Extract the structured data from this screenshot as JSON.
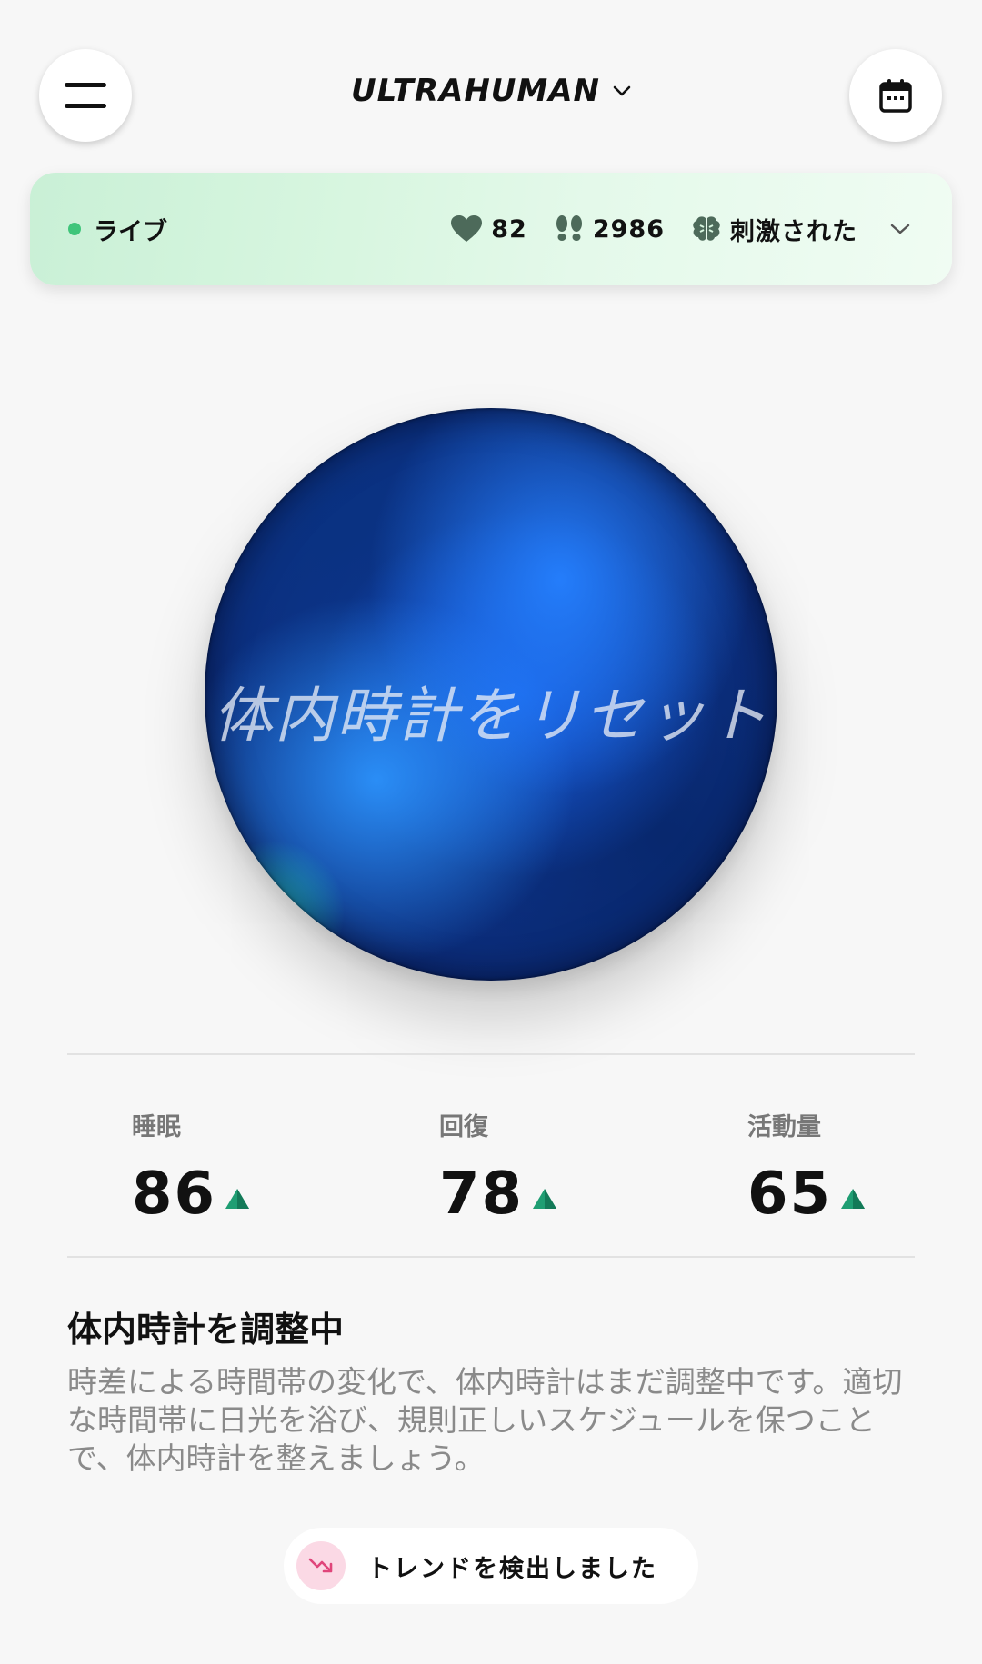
{
  "header": {
    "brand": "ULTRAHUMAN"
  },
  "live": {
    "label": "ライブ",
    "heart_rate": "82",
    "steps": "2986",
    "state": "刺激された"
  },
  "orb": {
    "text": "体内時計をリセット"
  },
  "scores": [
    {
      "label": "睡眠",
      "value": "86",
      "trend": "up"
    },
    {
      "label": "回復",
      "value": "78",
      "trend": "up"
    },
    {
      "label": "活動量",
      "value": "65",
      "trend": "up"
    }
  ],
  "insight": {
    "title": "体内時計を調整中",
    "body": "時差による時間帯の変化で、体内時計はまだ調整中です。適切な時間帯に日光を浴び、規則正しいスケジュールを保つことで、体内時計を整えましょう。"
  },
  "trend": {
    "label": "トレンドを検出しました"
  },
  "colors": {
    "live_dot": "#3fc57a",
    "up_arrow": "#1f9e73",
    "trend_icon_bg": "#fbd9e5",
    "trend_icon": "#e0457a"
  }
}
